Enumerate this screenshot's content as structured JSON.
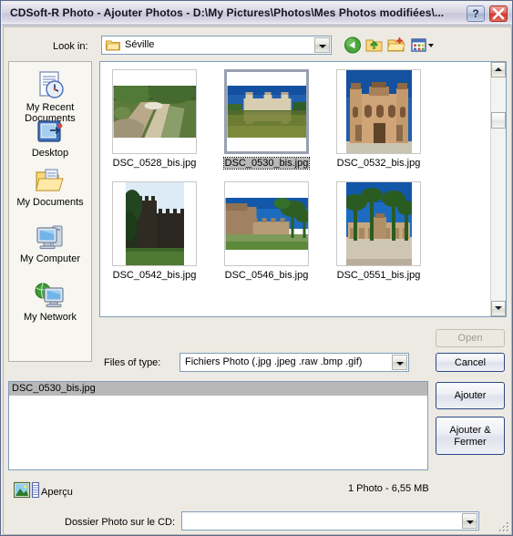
{
  "window": {
    "title": "CDSoft-R Photo - Ajouter Photos - D:\\My Pictures\\Photos\\Mes Photos modifiées\\...",
    "help_button": "?",
    "close_button": "✕"
  },
  "lookin": {
    "label": "Look in:",
    "value": "Séville",
    "folder_icon": "folder-icon",
    "tools": [
      {
        "name": "back-icon",
        "title": "Back"
      },
      {
        "name": "up-one-level-icon",
        "title": "Up One Level"
      },
      {
        "name": "new-folder-icon",
        "title": "Create New Folder"
      },
      {
        "name": "views-icon",
        "title": "Views"
      }
    ]
  },
  "places": {
    "items": [
      {
        "label": "My Recent",
        "label2": "Documents",
        "icon": "recent-documents-icon"
      },
      {
        "label": "Desktop",
        "label2": "",
        "icon": "desktop-icon"
      },
      {
        "label": "My Documents",
        "label2": "",
        "icon": "my-documents-icon"
      },
      {
        "label": "My Computer",
        "label2": "",
        "icon": "my-computer-icon"
      },
      {
        "label": "My Network",
        "label2": "",
        "icon": "my-network-icon"
      }
    ]
  },
  "files": [
    {
      "name": "DSC_0528_bis.jpg",
      "selected": false,
      "orientation": "landscape",
      "scene": "stream"
    },
    {
      "name": "DSC_0530_bis.jpg",
      "selected": true,
      "orientation": "landscape",
      "scene": "plaza-reflection"
    },
    {
      "name": "DSC_0532_bis.jpg",
      "selected": false,
      "orientation": "portrait-fill",
      "scene": "museum-facade"
    },
    {
      "name": "DSC_0542_bis.jpg",
      "selected": false,
      "orientation": "portrait",
      "scene": "castle-wall"
    },
    {
      "name": "DSC_0546_bis.jpg",
      "selected": false,
      "orientation": "landscape",
      "scene": "ramparts"
    },
    {
      "name": "DSC_0551_bis.jpg",
      "selected": false,
      "orientation": "portrait-fill",
      "scene": "palm-palace"
    }
  ],
  "filetype": {
    "label": "Files of type:",
    "value": "Fichiers Photo (.jpg .jpeg .raw .bmp .gif)"
  },
  "buttons": {
    "open": "Open",
    "open_disabled": true,
    "cancel": "Cancel",
    "ajouter": "Ajouter",
    "ajouter_fermer_line1": "Ajouter &",
    "ajouter_fermer_line2": "Fermer"
  },
  "selected_list": {
    "rows": [
      "DSC_0530_bis.jpg"
    ]
  },
  "footer": {
    "apercu_label": "Aperçu",
    "apercu_icon": "preview-image-icon",
    "photo_count": "1 Photo - 6,55 MB",
    "cd_label": "Dossier Photo sur le CD:",
    "cd_value": ""
  },
  "colors": {
    "dialog_face": "#eceae3",
    "title_gradient_mid": "#c8c7d8",
    "selection_grey": "#b8b8b8",
    "field_border": "#7f9db9",
    "button_border": "#2b4a86",
    "close_red": "#cf3b2e"
  }
}
